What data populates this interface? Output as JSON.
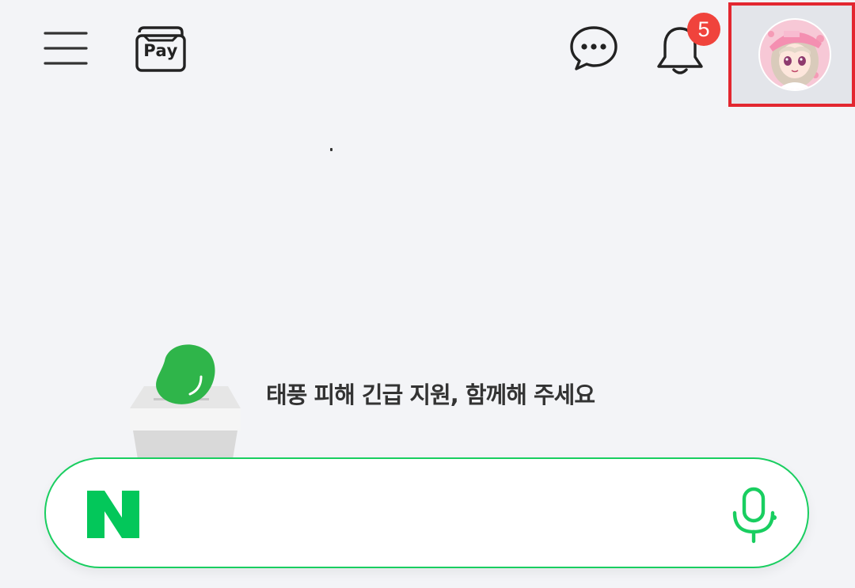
{
  "header": {
    "menu_icon": "hamburger-menu-icon",
    "pay_label": "Pay",
    "talk_icon": "chat-bubble-icon",
    "notification_icon": "bell-icon",
    "notification_count": "5",
    "profile_icon": "avatar"
  },
  "banner": {
    "text": "태풍 피해 긴급 지원, 함께해 주세요",
    "illustration": "donation-box-icon"
  },
  "search": {
    "logo_icon": "naver-n-logo",
    "value": "",
    "placeholder": "",
    "mic_icon": "microphone-icon"
  },
  "colors": {
    "background": "#f3f4f7",
    "naver_green": "#19ce60",
    "badge_red": "#f0433c",
    "highlight_red": "#e32730"
  }
}
